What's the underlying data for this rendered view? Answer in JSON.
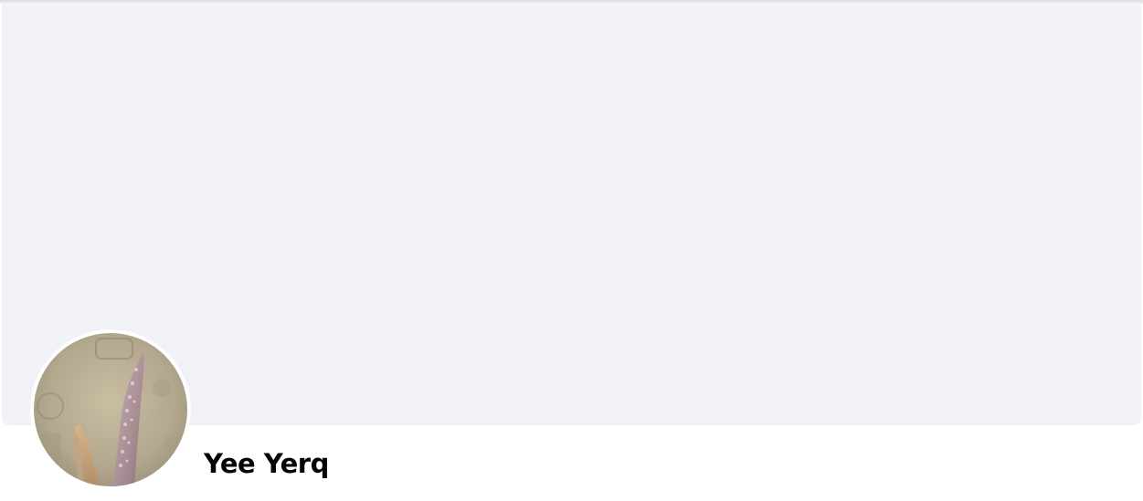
{
  "profile": {
    "name": "Yee Yerq",
    "avatar_icon": "profile-photo-plant-icon"
  },
  "colors": {
    "cover_background": "#f0f2f5",
    "page_background": "#ffffff",
    "name_text": "#050505"
  }
}
